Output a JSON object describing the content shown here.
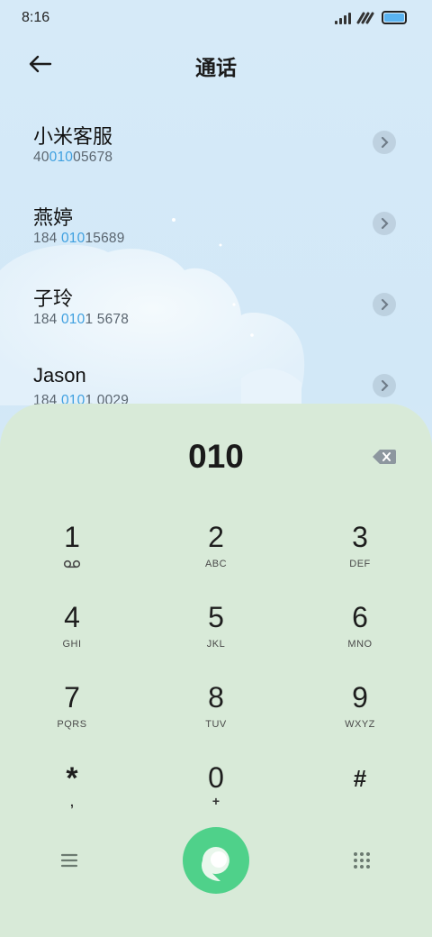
{
  "status_bar": {
    "time": "8:16",
    "battery_color": "#5ab3f0"
  },
  "header": {
    "title": "通话",
    "back_icon": "arrow-left-icon"
  },
  "contacts": [
    {
      "name": "小米客服",
      "number_pre": "40",
      "number_hl": "010",
      "number_post": "05678"
    },
    {
      "name": "燕婷",
      "number_pre": "184 ",
      "number_hl": "010",
      "number_post": "15689"
    },
    {
      "name": "子玲",
      "number_pre": "184 ",
      "number_hl": "010",
      "number_post": "1 5678"
    },
    {
      "name": "Jason",
      "number_pre": "184 ",
      "number_hl": "010",
      "number_post": "1 0029"
    }
  ],
  "dialer": {
    "input": "010",
    "delete_icon": "backspace-icon",
    "keys": [
      {
        "digit": "1",
        "letters": ""
      },
      {
        "digit": "2",
        "letters": "ABC"
      },
      {
        "digit": "3",
        "letters": "DEF"
      },
      {
        "digit": "4",
        "letters": "GHI"
      },
      {
        "digit": "5",
        "letters": "JKL"
      },
      {
        "digit": "6",
        "letters": "MNO"
      },
      {
        "digit": "7",
        "letters": "PQRS"
      },
      {
        "digit": "8",
        "letters": "TUV"
      },
      {
        "digit": "9",
        "letters": "WXYZ"
      },
      {
        "digit": "*",
        "letters": ","
      },
      {
        "digit": "0",
        "letters": "+"
      },
      {
        "digit": "#",
        "letters": ""
      }
    ]
  },
  "bottom_bar": {
    "menu_icon": "menu-icon",
    "call_icon": "call-icon",
    "keypad_icon": "keypad-grid-icon",
    "call_color": "#4fd18a"
  }
}
